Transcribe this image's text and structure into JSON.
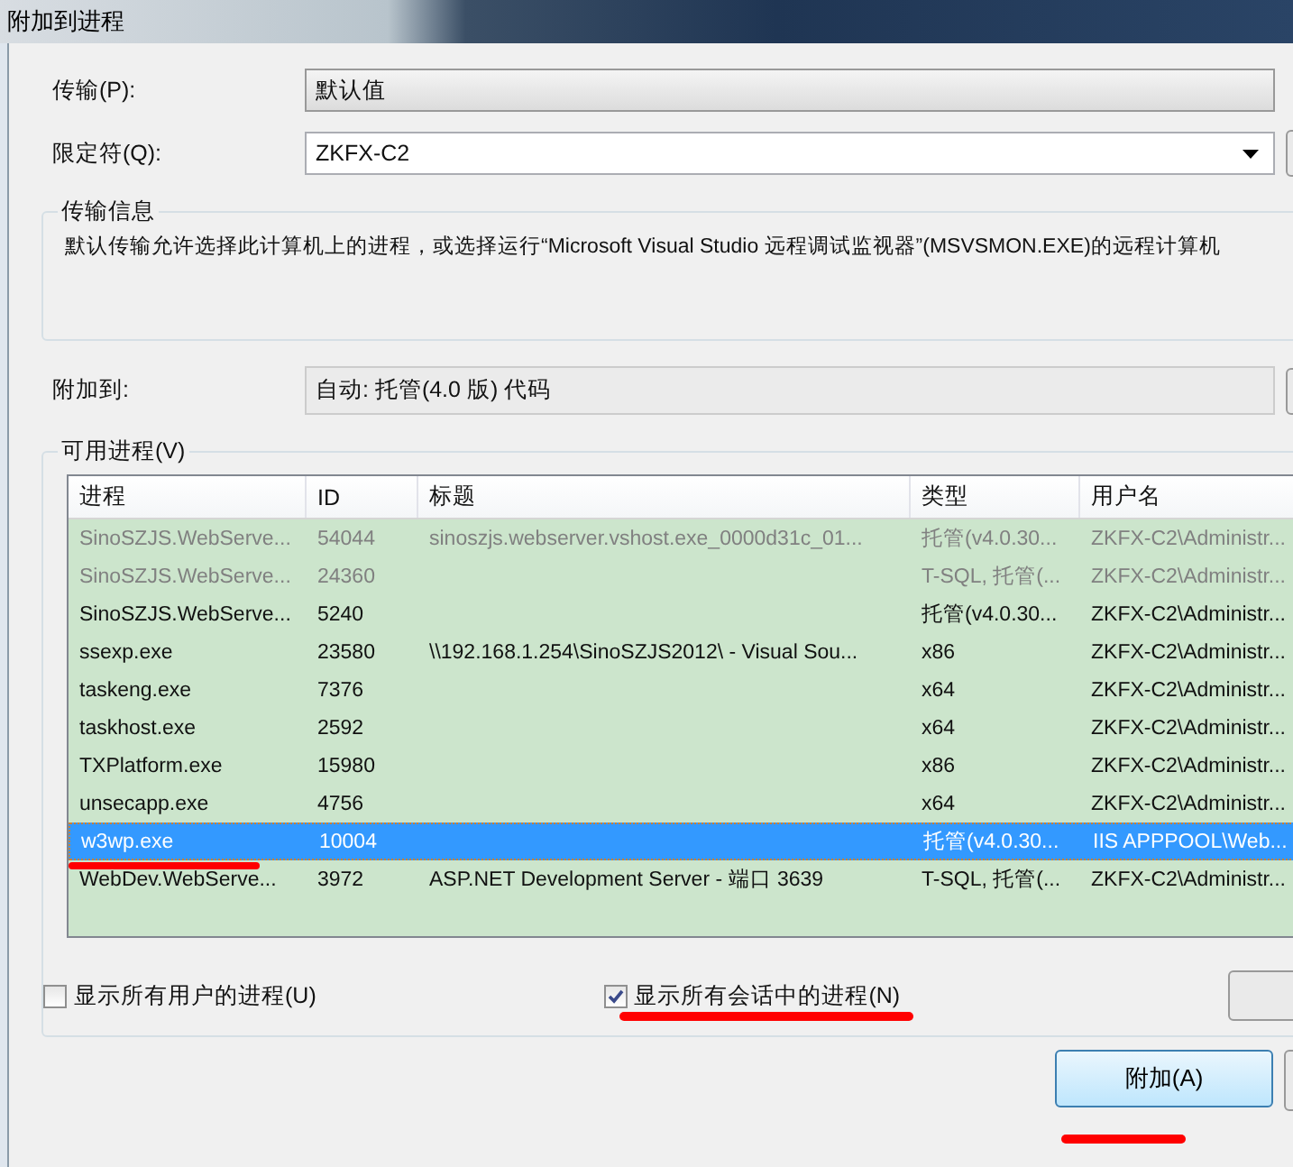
{
  "window": {
    "title": "附加到进程"
  },
  "transport": {
    "label": "传输(P):",
    "value": "默认值"
  },
  "qualifier": {
    "label": "限定符(Q):",
    "value": "ZKFX-C2"
  },
  "transport_info": {
    "title": "传输信息",
    "text": "默认传输允许选择此计算机上的进程，或选择运行“Microsoft Visual Studio 远程调试监视器”(MSVSMON.EXE)的远程计算机"
  },
  "attach_to": {
    "label": "附加到:",
    "value": "自动: 托管(4.0 版) 代码"
  },
  "processes": {
    "title": "可用进程(V)",
    "columns": [
      "进程",
      "ID",
      "标题",
      "类型",
      "用户名"
    ],
    "rows": [
      {
        "cells": [
          "SinoSZJS.WebServe...",
          "54044",
          "sinoszjs.webserver.vshost.exe_0000d31c_01...",
          "托管(v4.0.30...",
          "ZKFX-C2\\Administr..."
        ],
        "disabled": true,
        "selected": false
      },
      {
        "cells": [
          "SinoSZJS.WebServe...",
          "24360",
          "",
          "T-SQL, 托管(...",
          "ZKFX-C2\\Administr..."
        ],
        "disabled": true,
        "selected": false
      },
      {
        "cells": [
          "SinoSZJS.WebServe...",
          "5240",
          "",
          "托管(v4.0.30...",
          "ZKFX-C2\\Administr..."
        ],
        "disabled": false,
        "selected": false
      },
      {
        "cells": [
          "ssexp.exe",
          "23580",
          "\\\\192.168.1.254\\SinoSZJS2012\\ - Visual Sou...",
          "x86",
          "ZKFX-C2\\Administr..."
        ],
        "disabled": false,
        "selected": false
      },
      {
        "cells": [
          "taskeng.exe",
          "7376",
          "",
          "x64",
          "ZKFX-C2\\Administr..."
        ],
        "disabled": false,
        "selected": false
      },
      {
        "cells": [
          "taskhost.exe",
          "2592",
          "",
          "x64",
          "ZKFX-C2\\Administr..."
        ],
        "disabled": false,
        "selected": false
      },
      {
        "cells": [
          "TXPlatform.exe",
          "15980",
          "",
          "x86",
          "ZKFX-C2\\Administr..."
        ],
        "disabled": false,
        "selected": false
      },
      {
        "cells": [
          "unsecapp.exe",
          "4756",
          "",
          "x64",
          "ZKFX-C2\\Administr..."
        ],
        "disabled": false,
        "selected": false
      },
      {
        "cells": [
          "w3wp.exe",
          "10004",
          "",
          "托管(v4.0.30...",
          "IIS APPPOOL\\Web..."
        ],
        "disabled": false,
        "selected": true
      },
      {
        "cells": [
          "WebDev.WebServe...",
          "3972",
          "ASP.NET Development Server - 端口 3639",
          "T-SQL, 托管(...",
          "ZKFX-C2\\Administr..."
        ],
        "disabled": false,
        "selected": false
      }
    ]
  },
  "options": [
    {
      "label": "显示所有用户的进程(U)",
      "checked": false
    },
    {
      "label": "显示所有会话中的进程(N)",
      "checked": true
    }
  ],
  "buttons": [
    {
      "label": "附加(A)"
    }
  ]
}
